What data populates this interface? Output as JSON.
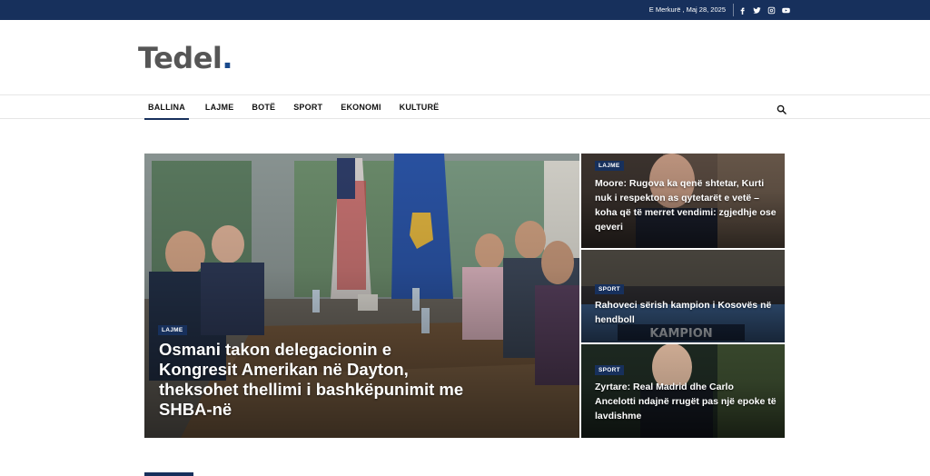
{
  "topbar": {
    "date": "E Merkurë , Maj 28, 2025",
    "social": [
      "facebook-icon",
      "twitter-icon",
      "instagram-icon",
      "youtube-icon"
    ]
  },
  "logo": {
    "text": "Tedel",
    "dot": "."
  },
  "nav": {
    "items": [
      {
        "label": "BALLINA",
        "active": true
      },
      {
        "label": "LAJME"
      },
      {
        "label": "BOTË"
      },
      {
        "label": "SPORT"
      },
      {
        "label": "EKONOMI"
      },
      {
        "label": "KULTURË"
      }
    ],
    "search_icon": "search-icon"
  },
  "featured": {
    "main": {
      "category": "LAJME",
      "title": "Osmani takon delegacionin e Kongresit Amerikan në Dayton, theksohet thellimi i bashkëpunimit me SHBA-në"
    },
    "side": [
      {
        "category": "LAJME",
        "title": "Moore: Rugova ka qenë shtetar, Kurti nuk i respekton as qytetarët e vetë – koha që të merret vendimi: zgjedhje ose qeveri"
      },
      {
        "category": "SPORT",
        "title": "Rahoveci sërish kampion i Kosovës në hendboll"
      },
      {
        "category": "SPORT",
        "title": "Zyrtare: Real Madrid dhe Carlo Ancelotti ndajnë rrugët pas një epoke të lavdishme"
      }
    ]
  },
  "colors": {
    "brand": "#17305c",
    "logo_dot": "#1a4a8c"
  }
}
